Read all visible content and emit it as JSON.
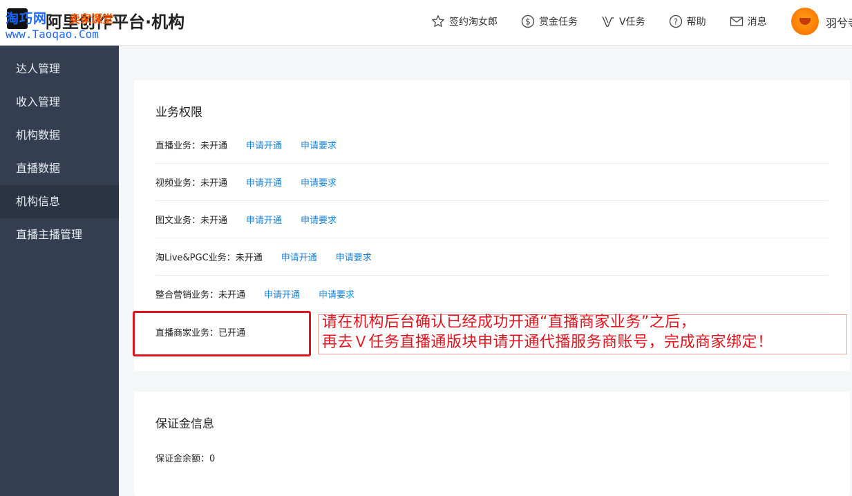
{
  "header": {
    "logo_watermark_1": "淘巧网",
    "logo_watermark_2": "卖家课堂",
    "logo_title": "阿里创作平台·机构",
    "logo_url": "www.Taoqao.Com",
    "nav": [
      {
        "label": "签约淘女郎",
        "icon": "star-icon"
      },
      {
        "label": "赏金任务",
        "icon": "dollar-icon"
      },
      {
        "label": "V任务",
        "icon": "v-icon"
      },
      {
        "label": "帮助",
        "icon": "help-icon"
      },
      {
        "label": "消息",
        "icon": "mail-icon"
      }
    ],
    "username": "羽兮寺"
  },
  "sidebar": {
    "items": [
      {
        "label": "达人管理"
      },
      {
        "label": "收入管理"
      },
      {
        "label": "机构数据"
      },
      {
        "label": "直播数据"
      },
      {
        "label": "机构信息",
        "active": true
      },
      {
        "label": "直播主播管理"
      }
    ]
  },
  "permissions": {
    "title": "业务权限",
    "rows": [
      {
        "label": "直播业务：",
        "status": "未开通",
        "apply": "申请开通",
        "requirements": "申请要求"
      },
      {
        "label": "视频业务：",
        "status": "未开通",
        "apply": "申请开通",
        "requirements": "申请要求"
      },
      {
        "label": "图文业务：",
        "status": "未开通",
        "apply": "申请开通",
        "requirements": "申请要求"
      },
      {
        "label": "淘Live&PGC业务：",
        "status": "未开通",
        "apply": "申请开通",
        "requirements": "申请要求"
      },
      {
        "label": "整合营销业务：",
        "status": "未开通",
        "apply": "申请开通",
        "requirements": "申请要求"
      },
      {
        "label": "直播商家业务：",
        "status": "已开通"
      }
    ]
  },
  "annotation": {
    "line1": "请在机构后台确认已经成功开通“直播商家业务”之后，",
    "line2": "再去Ｖ任务直播通版块申请开通代播服务商账号，完成商家绑定！",
    "color": "#e0141e"
  },
  "deposit": {
    "title": "保证金信息",
    "label": "保证金余额：",
    "value": "0"
  },
  "colors": {
    "sidebar_bg": "#333f50",
    "link": "#1a82d6",
    "accent_red": "#e0141e"
  }
}
